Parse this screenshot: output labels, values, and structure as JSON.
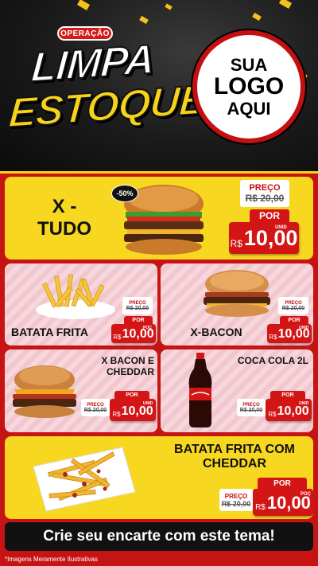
{
  "header": {
    "badge": "OPERAÇÃO",
    "title_line1": "LIMPA",
    "title_line2": "ESTOQUE",
    "logo_line1": "SUA",
    "logo_line2": "LOGO",
    "logo_line3": "AQUI"
  },
  "products": [
    {
      "name": "X - TUDO",
      "badge": "-50%",
      "preco_label": "PREÇO",
      "old_price": "R$ 20,00",
      "por_label": "POR",
      "currency": "R$",
      "price": "10,00",
      "unit": "UNID",
      "image": "burger-icon"
    },
    {
      "name": "BATATA FRITA",
      "preco_label": "PREÇO",
      "old_price": "R$ 20,00",
      "por_label": "POR",
      "currency": "R$",
      "price": "10,00",
      "unit": "POÇ",
      "image": "fries-icon"
    },
    {
      "name": "X-BACON",
      "preco_label": "PREÇO",
      "old_price": "R$ 20,00",
      "por_label": "POR",
      "currency": "R$",
      "price": "10,00",
      "unit": "UNID",
      "image": "burger-icon"
    },
    {
      "name": "X BACON E CHEDDAR",
      "preco_label": "PREÇO",
      "old_price": "R$ 20,00",
      "por_label": "POR",
      "currency": "R$",
      "price": "10,00",
      "unit": "UNID",
      "image": "burger-icon"
    },
    {
      "name": "COCA COLA 2L",
      "preco_label": "PREÇO",
      "old_price": "R$ 20,00",
      "por_label": "POR",
      "currency": "R$",
      "price": "10,00",
      "unit": "UNID",
      "image": "soda-bottle-icon"
    },
    {
      "name": "BATATA FRITA COM CHEDDAR",
      "preco_label": "PREÇO",
      "old_price": "R$ 20,00",
      "por_label": "POR",
      "currency": "R$",
      "price": "10,00",
      "unit": "POÇ",
      "image": "fries-icon"
    }
  ],
  "footer": {
    "cta": "Crie seu encarte com este tema!",
    "disclaimer": "*Imagens Meramente Ilustrativas"
  },
  "colors": {
    "red": "#d31515",
    "yellow": "#f7d71f",
    "dark": "#111111",
    "pink": "#f7d7dc"
  }
}
